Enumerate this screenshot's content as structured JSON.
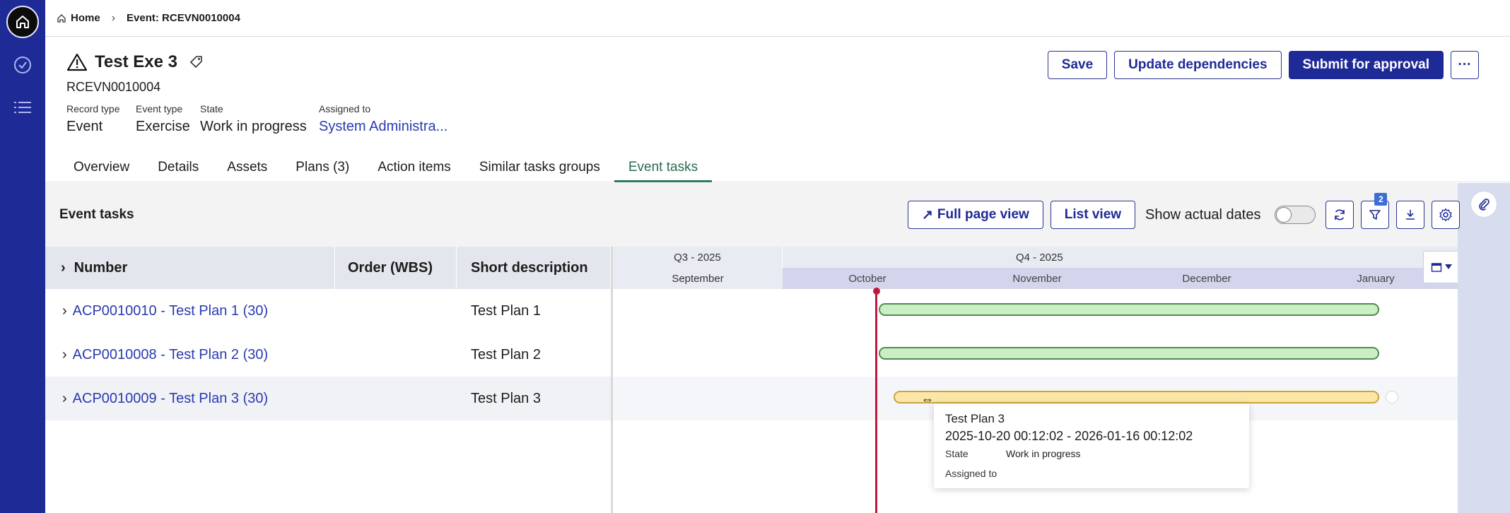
{
  "breadcrumb": {
    "home": "Home",
    "current": "Event: RCEVN0010004"
  },
  "header": {
    "title": "Test Exe 3",
    "record_number": "RCEVN0010004",
    "meta": [
      {
        "label": "Record type",
        "value": "Event"
      },
      {
        "label": "Event type",
        "value": "Exercise"
      },
      {
        "label": "State",
        "value": "Work in progress"
      },
      {
        "label": "Assigned to",
        "value": "System Administra..."
      }
    ],
    "actions": {
      "save": "Save",
      "update": "Update dependencies",
      "submit": "Submit for approval",
      "more": "···"
    }
  },
  "tabs": [
    "Overview",
    "Details",
    "Assets",
    "Plans (3)",
    "Action items",
    "Similar tasks groups",
    "Event tasks"
  ],
  "active_tab": "Event tasks",
  "panel": {
    "title": "Event tasks",
    "full_page": "Full page view",
    "list_view": "List view",
    "show_actual": "Show actual dates",
    "filter_count": "2"
  },
  "grid": {
    "columns": {
      "number": "Number",
      "order": "Order (WBS)",
      "desc": "Short description"
    },
    "rows": [
      {
        "number": "ACP0010010 - Test Plan 1 (30)",
        "order": "",
        "desc": "Test Plan 1"
      },
      {
        "number": "ACP0010008 - Test Plan 2 (30)",
        "order": "",
        "desc": "Test Plan 2"
      },
      {
        "number": "ACP0010009 - Test Plan 3 (30)",
        "order": "",
        "desc": "Test Plan 3"
      }
    ]
  },
  "gantt": {
    "quarters": [
      "Q3 - 2025",
      "Q4 - 2025"
    ],
    "months": [
      "September",
      "October",
      "November",
      "December",
      "January"
    ]
  },
  "tooltip": {
    "title": "Test Plan 3",
    "dates": "2025-10-20 00:12:02 - 2026-01-16 00:12:02",
    "state_label": "State",
    "state_value": "Work in progress",
    "assigned_label": "Assigned to"
  },
  "colors": {
    "rail": "#1e2a96",
    "accent": "#1e2a96",
    "today": "#c2183c",
    "bar_green": "#cbeec4",
    "bar_yellow": "#fbe6a6",
    "tab_active": "#2d6a4f"
  }
}
